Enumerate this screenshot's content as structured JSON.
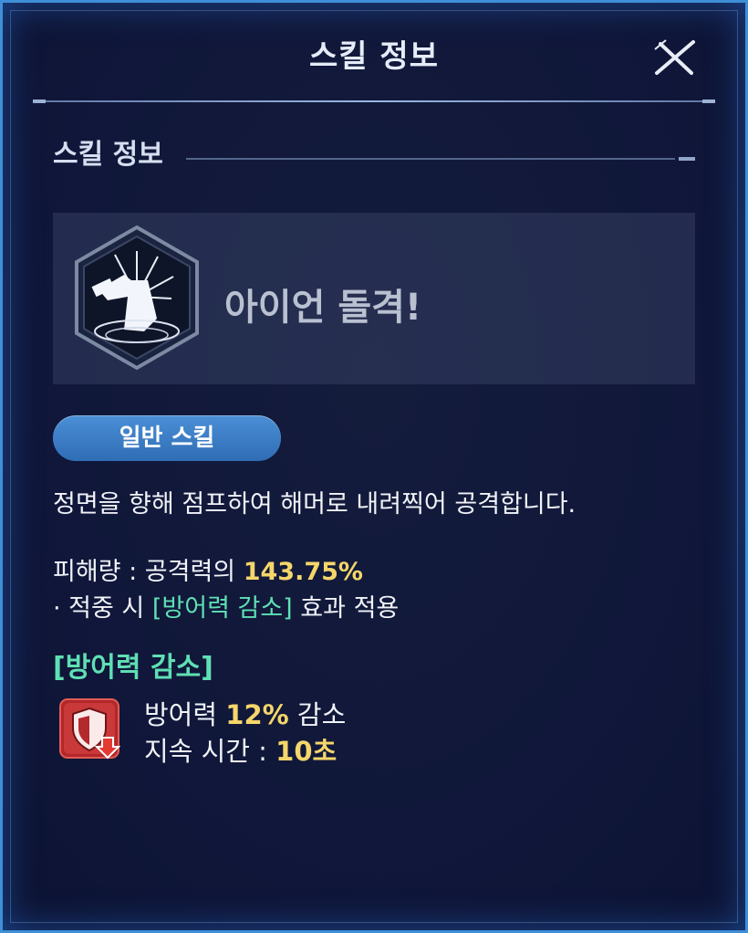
{
  "header": {
    "title": "스킬 정보"
  },
  "section": {
    "title": "스킬 정보"
  },
  "skill": {
    "name": "아이언 돌격!",
    "type_label": "일반 스킬",
    "description": "정면을 향해 점프하여 해머로 내려찍어 공격합니다."
  },
  "stats": {
    "damage_label": "피해량 : 공격력의 ",
    "damage_value": "143.75%",
    "onhit_prefix": "· 적중 시 ",
    "onhit_effect": "[방어력 감소]",
    "onhit_suffix": " 효과 적용"
  },
  "effect": {
    "title": "[방어력 감소]",
    "line1_prefix": "방어력 ",
    "line1_value": "12%",
    "line1_suffix": " 감소",
    "line2_prefix": "지속 시간 : ",
    "line2_value": "10초"
  },
  "icons": {
    "close": "close-icon",
    "skill": "hammer-strike-skill-icon",
    "effect": "defense-down-shield-icon"
  },
  "colors": {
    "accent_blue": "#3f8fd8",
    "highlight_yellow": "#f5d66a",
    "highlight_green": "#5fe0b4"
  }
}
